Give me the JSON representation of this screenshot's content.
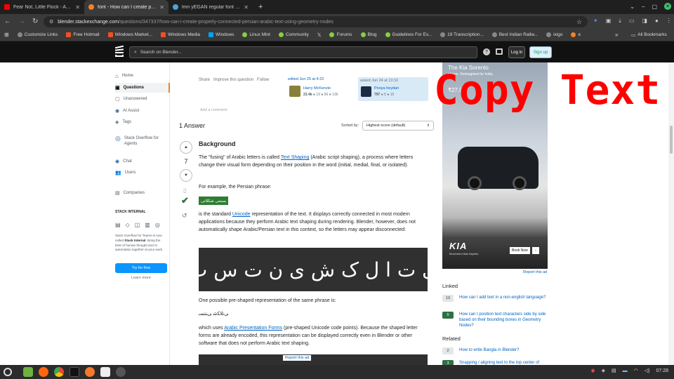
{
  "browser": {
    "tabs": [
      {
        "title": "Fear Not, Little Flock - A Cap",
        "color": "#ff0000"
      },
      {
        "title": "font - How can I create prope",
        "color": "#f48225"
      },
      {
        "title": "lmn yEGAN regular font unic",
        "color": "#4aa3df"
      }
    ],
    "new_tab": "+",
    "url_domain": "blender.stackexchange.com",
    "url_path": "/questions/347337/how-can-i-create-properly-connected-persian-arabic-text-using-geometry-nodes",
    "bookmarks": [
      "Customize Links",
      "Free Hotmail",
      "Windows Market...",
      "Windows Media",
      "Windows",
      "Linux Mint",
      "Community",
      "Forums",
      "Blog",
      "Guidelines For Ev...",
      "19 Transcription...",
      "Best Indian Railw...",
      "ixigo",
      "e"
    ],
    "bookmarks_more": "»",
    "all_bookmarks": "All Bookmarks"
  },
  "so": {
    "search_placeholder": "Search on Blender...",
    "login": "Log in",
    "signup": "Sign up"
  },
  "nav": {
    "items": [
      "Home",
      "Questions",
      "Unanswered",
      "AI Assist",
      "Tags",
      "Stack Overflow for Agents",
      "Chat",
      "Users",
      "Companies"
    ],
    "stack_internal_title": "STACK INTERNAL",
    "stack_internal_text_1": "Stack Overflow for Teams is now called",
    "stack_internal_bold": "Stack Internal",
    "stack_internal_text_2": ". Bring the best of human thought and AI automation together at your work.",
    "try_free": "Try for free",
    "learn_more": "Learn more"
  },
  "question_footer": {
    "share": "Share",
    "improve": "Improve this question",
    "follow": "Follow",
    "edited": "edited Jun 25 at 4:22",
    "editor_name": "Harry McKenzie",
    "editor_rep": "23.4k",
    "editor_badges": "● 19  ● 56  ● 136",
    "asked": "asked Jun 24 at 13:32",
    "asker_name": "Pooya heydari",
    "asker_rep": "797",
    "asker_badges": "● 5  ● 15",
    "add_comment": "Add a comment"
  },
  "answers": {
    "count_label": "1 Answer",
    "sorted_by": "Sorted by:",
    "sort_value": "Highest score (default)",
    "vote_count": "7"
  },
  "answer": {
    "heading": "Background",
    "p1_a": "The \"fusing\" of Arabic letters is called ",
    "p1_link": "Text Shaping",
    "p1_b": " (Arabic script shaping), a process where letters change their visual form depending on their position in the word (initial, medial, final, or isolated).",
    "p2": "For example, the Persian phrase:",
    "code1": "بستنی شکلاتی",
    "p3_a": "is the standard ",
    "p3_link": "Unicode",
    "p3_b": " representation of the text. It displays correctly connected in most modern applications because they perform Arabic text shaping during rendering. Blender, however, does not automatically shape Arabic/Persian text in this context, so the letters may appear disconnected:",
    "image_text": "ی ت ا ل ک ش ی ن ت س ب",
    "p4": "One possible pre-shaped representation of the same phrase is:",
    "code2": "ﯽﺗﻼﮑﺷ ﯽﻨﺘﺴﺑ",
    "p5_a": "which uses ",
    "p5_link": "Arabic Presentation Forms",
    "p5_b": " (pre-shaped Unicode code points). Because the shaped letter forms are already encoded, this representation can be displayed correctly even in Blender or other software that does not perform Arabic text shaping.",
    "report_ad_inline": "Report this ad"
  },
  "ad": {
    "headline_1": "The Kia Sorento",
    "headline_2": "al icon. Reimagined for India.",
    "price": "₹27.0",
    "brand": "KIA",
    "tagline": "Movement that inspires",
    "cta": "Book Now",
    "report": "Report this ad"
  },
  "overlay": {
    "text": "Copy Text",
    "color": "#ff0000"
  },
  "linked": {
    "title": "Linked",
    "items": [
      {
        "score": "19",
        "text": "How can I add text in a non-english language?",
        "accepted": false
      },
      {
        "score": "5",
        "text": "How can I position text characters side by side based on their bounding boxes in Geometry Nodes?",
        "accepted": true
      }
    ]
  },
  "related": {
    "title": "Related",
    "items": [
      {
        "score": "2",
        "text": "How to write Bangla in Blender?",
        "accepted": false
      },
      {
        "score": "3",
        "text": "Snapping / aligning text to the top center of",
        "accepted": true
      }
    ]
  },
  "taskbar": {
    "time": "07:28"
  },
  "colors": {
    "so_orange": "#f48225",
    "accepted_green": "#2f6f44",
    "link_blue": "#0063bf",
    "primary_btn": "#0a95ff"
  }
}
